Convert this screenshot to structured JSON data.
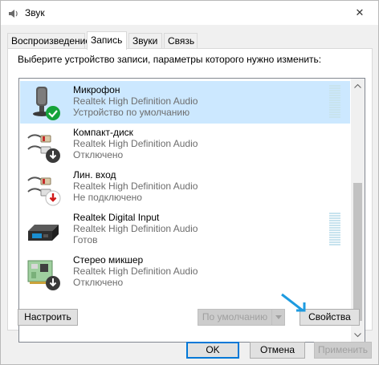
{
  "window": {
    "title": "Звук",
    "close_label": "✕"
  },
  "tabs": [
    {
      "label": "Воспроизведение",
      "active": false
    },
    {
      "label": "Запись",
      "active": true
    },
    {
      "label": "Звуки",
      "active": false
    },
    {
      "label": "Связь",
      "active": false
    }
  ],
  "panel": {
    "instruction": "Выберите устройство записи, параметры которого нужно изменить:"
  },
  "devices": [
    {
      "name": "Микрофон",
      "driver": "Realtek High Definition Audio",
      "status": "Устройство по умолчанию",
      "icon": "microphone-icon",
      "badge": "default-check-icon",
      "selected": true
    },
    {
      "name": "Компакт-диск",
      "driver": "Realtek High Definition Audio",
      "status": "Отключено",
      "icon": "rca-connector-icon",
      "badge": "disabled-arrow-icon",
      "selected": false
    },
    {
      "name": "Лин. вход",
      "driver": "Realtek High Definition Audio",
      "status": "Не подключено",
      "icon": "rca-connector-icon",
      "badge": "unplugged-arrow-icon",
      "selected": false
    },
    {
      "name": "Realtek Digital Input",
      "driver": "Realtek High Definition Audio",
      "status": "Готов",
      "icon": "digital-input-icon",
      "badge": "",
      "selected": false
    },
    {
      "name": "Стерео микшер",
      "driver": "Realtek High Definition Audio",
      "status": "Отключено",
      "icon": "sound-card-icon",
      "badge": "disabled-arrow-icon",
      "selected": false
    }
  ],
  "buttons": {
    "configure": "Настроить",
    "set_default": "По умолчанию",
    "properties": "Свойства",
    "ok": "OK",
    "cancel": "Отмена",
    "apply": "Применить"
  },
  "colors": {
    "selection": "#cce8ff",
    "accent": "#0078d7",
    "check_green": "#15a33a",
    "unplugged_red": "#d11919"
  }
}
